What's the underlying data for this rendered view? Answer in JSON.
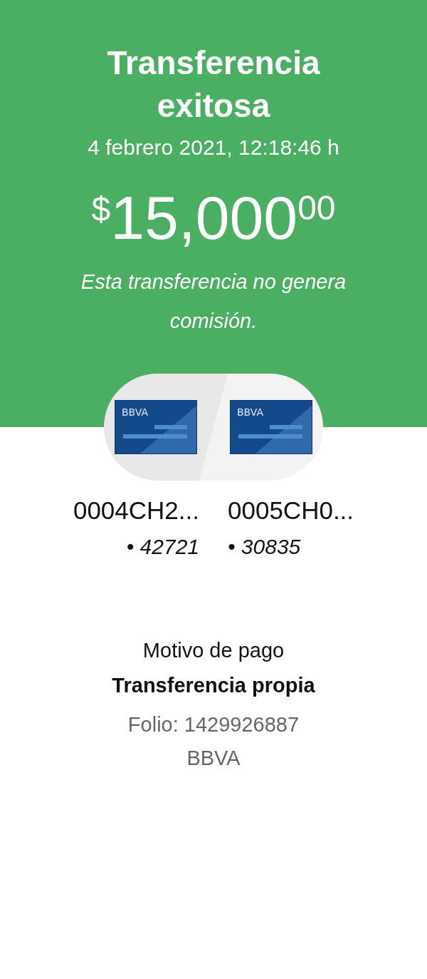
{
  "header": {
    "title": "Transferencia exitosa",
    "datetime": "4 febrero 2021, 12:18:46 h",
    "amount": {
      "currency": "$",
      "whole": "15,000",
      "cents": "00"
    },
    "note": "Esta transferencia no genera comisión."
  },
  "accounts": [
    {
      "brand": "BBVA",
      "name": "0004CH2...",
      "mask": "• 42721"
    },
    {
      "brand": "BBVA",
      "name": "0005CH0...",
      "mask": "• 30835"
    }
  ],
  "details": {
    "label": "Motivo de pago",
    "value": "Transferencia propia",
    "folio": "Folio: 1429926887",
    "bank": "BBVA"
  }
}
